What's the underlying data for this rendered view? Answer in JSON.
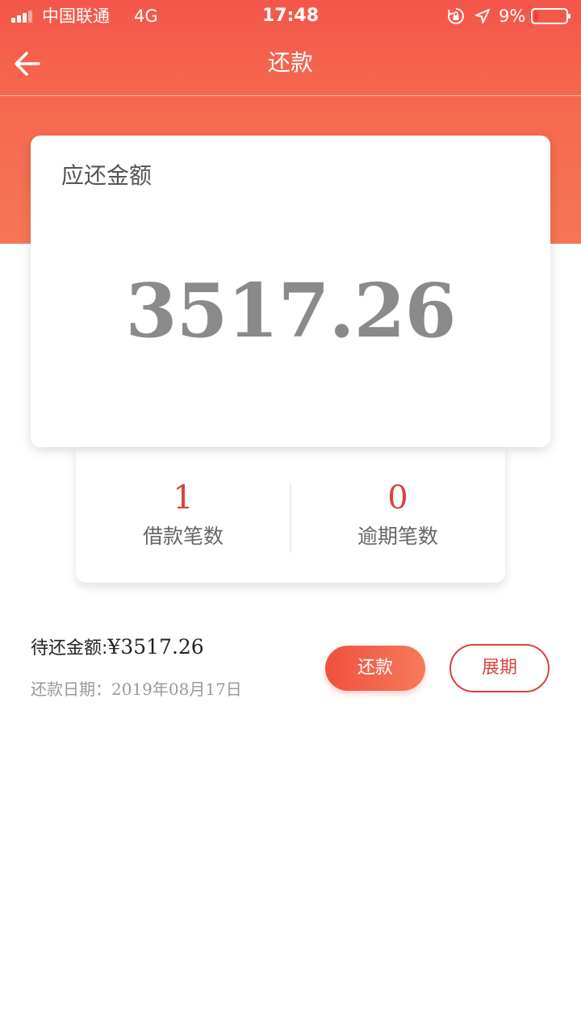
{
  "status_bar": {
    "carrier": "中国联通",
    "network": "4G",
    "time": "17:48",
    "battery": "9%",
    "icons": [
      "signal-icon",
      "orientation-lock-icon",
      "location-icon",
      "battery-icon"
    ]
  },
  "nav": {
    "title": "还款",
    "back_icon": "arrow-left-icon"
  },
  "summary_card": {
    "label": "应还金额",
    "amount": "3517.26"
  },
  "stats": {
    "loans": {
      "count": "1",
      "label": "借款笔数"
    },
    "overdue": {
      "count": "0",
      "label": "逾期笔数"
    }
  },
  "bill": {
    "due_label": "待还金额:",
    "due_amount": "¥3517.26",
    "date_label": "还款日期：",
    "date_value": "2019年08月17日",
    "repay_label": "还款",
    "extend_label": "展期"
  },
  "colors": {
    "header_gradient_top": "#f4564a",
    "header_gradient_bottom": "#f57656",
    "accent_red": "#d9443a",
    "amount_gray": "#8a8a8a"
  }
}
